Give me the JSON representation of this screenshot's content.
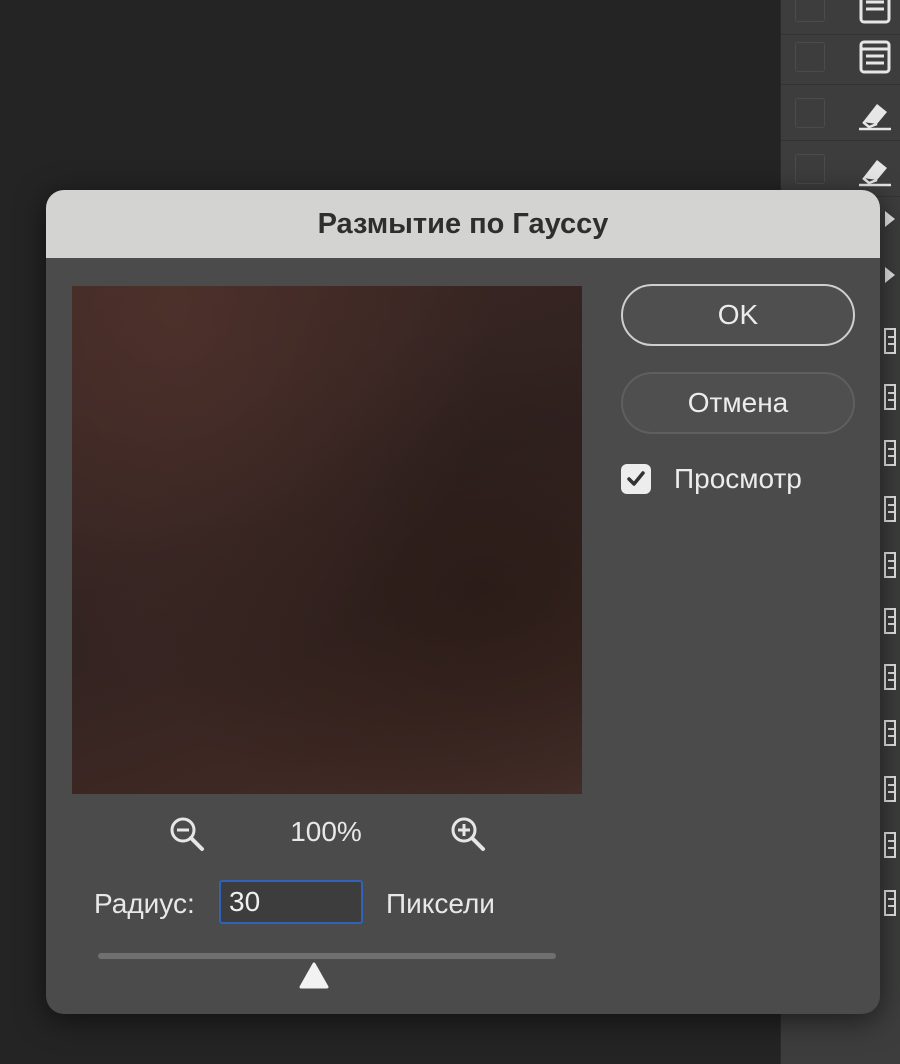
{
  "dialog": {
    "title": "Размытие по Гауссу",
    "ok_label": "OK",
    "cancel_label": "Отмена",
    "preview_label": "Просмотр",
    "preview_checked": true,
    "zoom_level": "100%",
    "radius_label": "Радиус:",
    "radius_value": "30",
    "units_label": "Пиксели",
    "slider_level": 0.47
  },
  "icons": {
    "zoom_out": "zoom-out-icon",
    "zoom_in": "zoom-in-icon",
    "checkbox": "checkmark-icon",
    "slider": "triangle-thumb-icon",
    "layer_doc": "document-icon",
    "layer_eraser": "eraser-icon",
    "layer_expand": "expand-arrow-icon",
    "layer_menu": "list-icon"
  },
  "colors": {
    "accent_focus": "#2f62b8",
    "dialog_bg": "#4a4b4a",
    "titlebar_bg": "#d3d4d2"
  }
}
